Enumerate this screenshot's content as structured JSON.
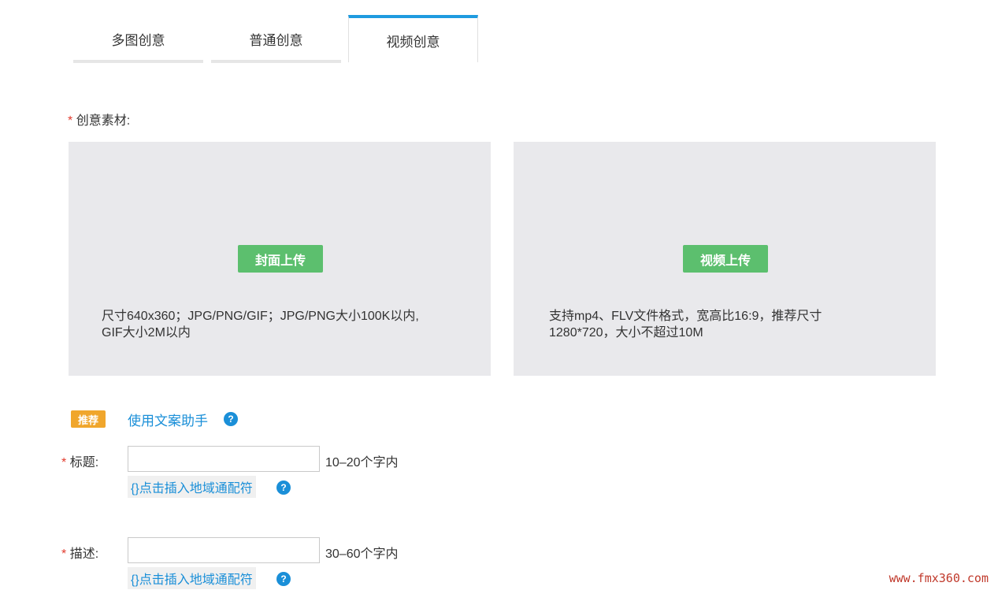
{
  "tabs": [
    {
      "label": "多图创意",
      "active": false
    },
    {
      "label": "普通创意",
      "active": false
    },
    {
      "label": "视频创意",
      "active": true
    }
  ],
  "required_mark": "*",
  "material": {
    "label": "创意素材:",
    "cover": {
      "button": "封面上传",
      "hint_line1": "尺寸640x360；JPG/PNG/GIF；JPG/PNG大小100K以内,",
      "hint_line2": "GIF大小2M以内"
    },
    "video": {
      "button": "视频上传",
      "hint_line1": "支持mp4、FLV文件格式，宽高比16:9，推荐尺寸",
      "hint_line2": "1280*720，大小不超过10M"
    }
  },
  "assistant": {
    "badge": "推荐",
    "link": "使用文案助手",
    "help_glyph": "?"
  },
  "title_field": {
    "label": "标题:",
    "value": "",
    "limit": "10–20个字内",
    "insert": "{}点击插入地域通配符"
  },
  "desc_field": {
    "label": "描述:",
    "value": "",
    "limit": "30–60个字内",
    "insert": "{}点击插入地域通配符"
  },
  "watermark": "www.fmx360.com",
  "colors": {
    "accent": "#1e9be0",
    "upload_button": "#5cbf6e",
    "badge": "#f0a62c",
    "required": "#e23b2e",
    "link": "#1a8fd8"
  }
}
